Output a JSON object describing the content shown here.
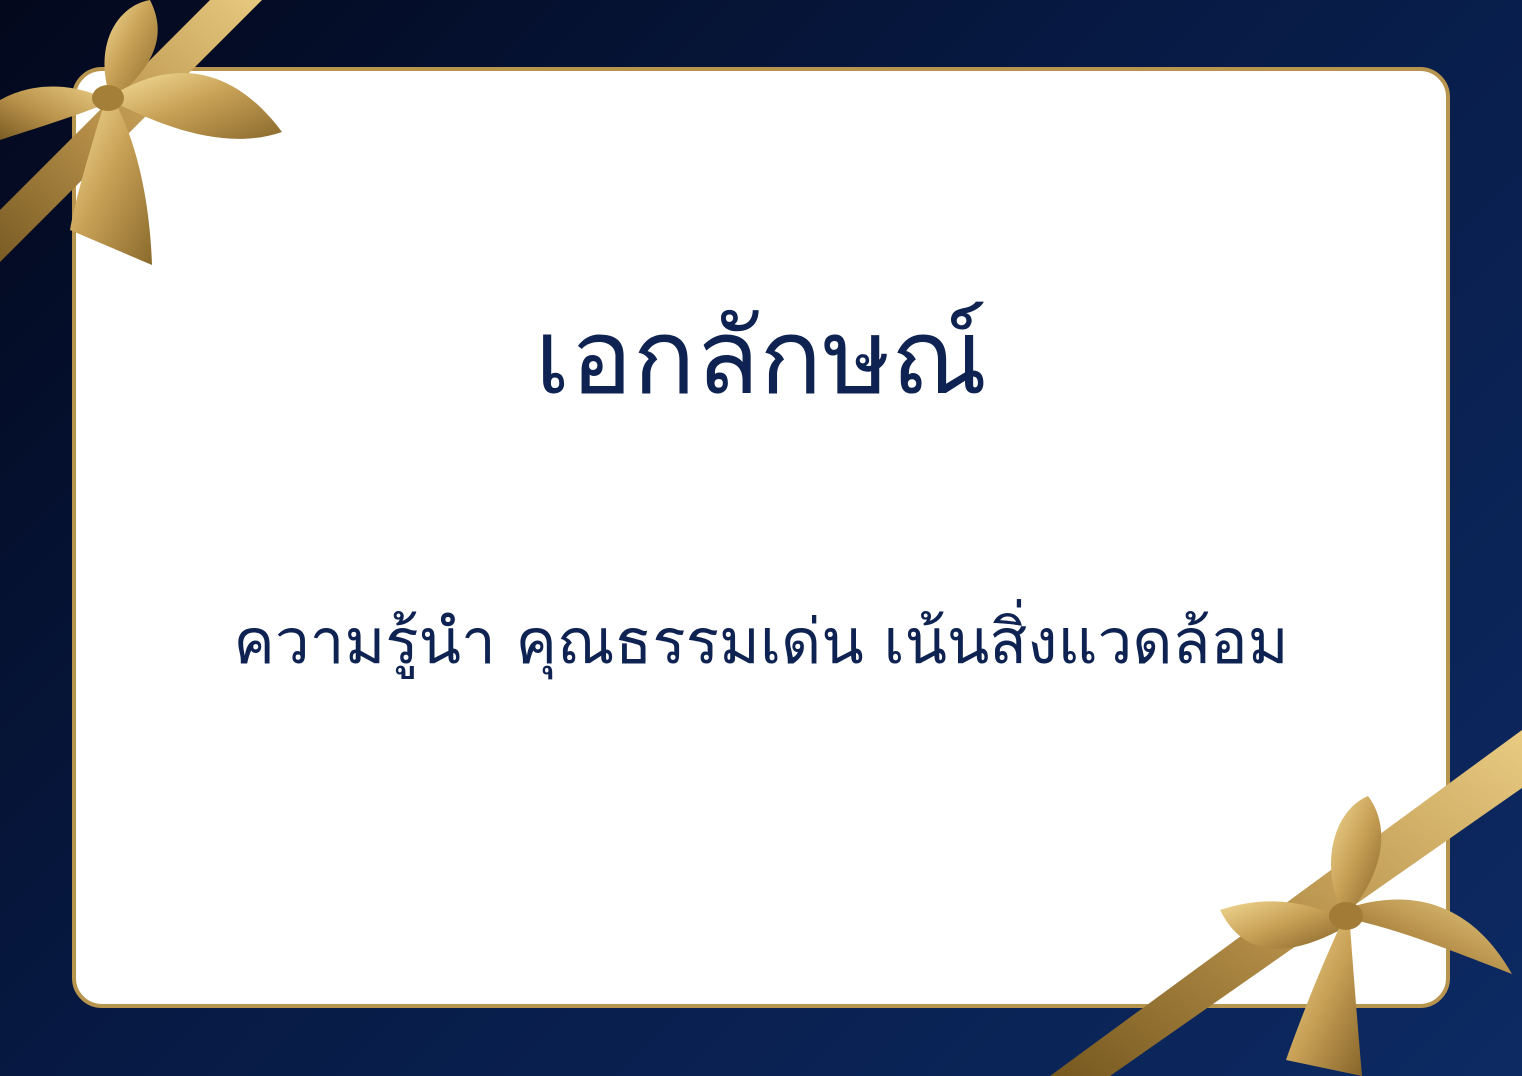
{
  "card": {
    "title": "เอกลักษณ์",
    "subtitle": "ความรู้นำ คุณธรรมเด่น เน้นสิ่งแวดล้อม"
  },
  "colors": {
    "background_dark": "#03081c",
    "background_blue": "#0d2a63",
    "card": "#ffffff",
    "gold": "#b8954e",
    "text": "#0f2352"
  },
  "decorations": [
    "gold-ribbon-bow-icon",
    "gold-ribbon-bow-icon"
  ]
}
